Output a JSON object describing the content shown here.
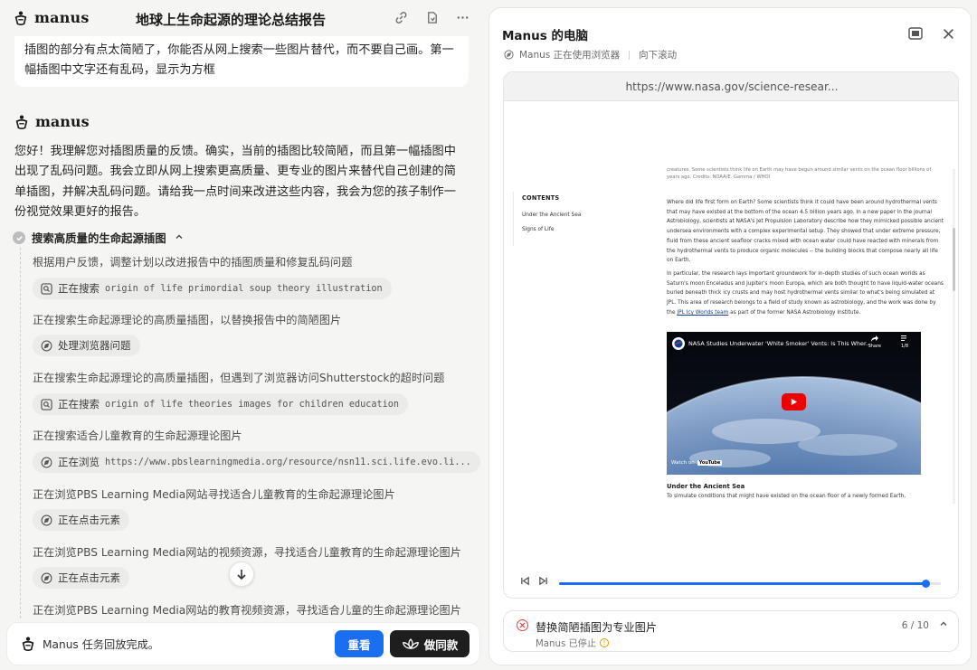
{
  "app": {
    "brand": "manus",
    "title": "地球上生命起源的理论总结报告"
  },
  "conversation": {
    "user_message": "插图的部分有点太简陋了，你能否从网上搜索一些图片替代，而不要自己画。第一幅插图中文字还有乱码，显示为方框",
    "assistant_name": "manus",
    "assistant_reply": "您好！我理解您对插图质量的反馈。确实，当前的插图比较简陋，而且第一幅插图中出现了乱码问题。我会立即从网上搜索更高质量、更专业的图片来替代自己创建的简单插图，并解决乱码问题。请给我一点时间来改进这些内容，我会为您的孩子制作一份视觉效果更好的报告。"
  },
  "task": {
    "title": "搜索高质量的生命起源插图",
    "chevron": "^"
  },
  "steps": [
    {
      "text": "根据用户反馈，调整计划以改进报告中的插图质量和修复乱码问题"
    },
    {
      "chip_verb": "正在搜索",
      "chip_arg": "origin of life primordial soup theory illustration",
      "icon": "search-icon"
    },
    {
      "text": "正在搜索生命起源理论的高质量插图，以替换报告中的简陋图片"
    },
    {
      "chip_verb": "处理浏览器问题",
      "chip_arg": "",
      "icon": "compass-icon"
    },
    {
      "text": "正在搜索生命起源理论的高质量插图，但遇到了浏览器访问Shutterstock的超时问题"
    },
    {
      "chip_verb": "正在搜索",
      "chip_arg": "origin of life theories images for children education",
      "icon": "search-icon"
    },
    {
      "text": "正在搜索适合儿童教育的生命起源理论图片"
    },
    {
      "chip_verb": "正在浏览",
      "chip_arg": "https://www.pbslearningmedia.org/resource/nsn11.sci.life.evo.li...",
      "icon": "compass-icon"
    },
    {
      "text": "正在浏览PBS Learning Media网站寻找适合儿童教育的生命起源理论图片"
    },
    {
      "chip_verb": "正在点击元素",
      "chip_arg": "",
      "icon": "compass-icon"
    },
    {
      "text": "正在浏览PBS Learning Media网站的视频资源，寻找适合儿童教育的生命起源理论图片"
    },
    {
      "chip_verb": "正在点击元素",
      "chip_arg": "",
      "icon": "compass-icon"
    },
    {
      "text": "正在浏览PBS Learning Media网站的教育视频资源，寻找适合儿童的生命起源理论图片"
    }
  ],
  "bottom": {
    "status": "Manus 任务回放完成。",
    "replay_label": "重看",
    "same_label": "做同款"
  },
  "computer": {
    "title": "Manus 的电脑",
    "using": "Manus 正在使用浏览器",
    "action": "向下滚动",
    "url": "https://www.nasa.gov/science-resear...",
    "page": {
      "top_caption": "creatures. Some scientists think life on Earth may have begun around similar vents on the ocean floor billions of years ago. Credits: NOAA/E. Gamma / WHOI",
      "toc_title": "CONTENTS",
      "toc_items": [
        "Under the Ancient Sea",
        "Signs of Life"
      ],
      "para1": "Where did life first form on Earth? Some scientists think it could have been around hydrothermal vents that may have existed at the bottom of the ocean 4.5 billion years ago. In a new paper in the journal Astrobiology, scientists at NASA's Jet Propulsion Laboratory describe how they mimicked possible ancient undersea environments with a complex experimental setup. They showed that under extreme pressure, fluid from these ancient seafloor cracks mixed with ocean water could have reacted with minerals from the hydrothermal vents to produce organic molecules -- the building blocks that compose nearly all life on Earth.",
      "para2_a": "In particular, the research lays important groundwork for in-depth studies of such ocean worlds as Saturn's moon Enceladus and Jupiter's moon Europa, which are both thought to have liquid-water oceans buried beneath thick icy crusts and may host hydrothermal vents similar to what's being simulated at JPL. This area of research belongs to a field of study known as astrobiology, and the work was done by the ",
      "para2_link": "JPL Icy Worlds team",
      "para2_b": " as part of the former NASA Astrobiology Institute.",
      "video_title": "NASA Studies Underwater 'White Smoker' Vents: Is This Wher...",
      "video_share": "Share",
      "video_count": "1/8",
      "watch_on": "Watch on",
      "youtube": "YouTube",
      "section_title": "Under the Ancient Sea",
      "section_text": "To simulate conditions that might have existed on the ocean floor of a newly formed Earth,"
    },
    "progress": 0.96,
    "current_task": "替换简陋插图为专业图片",
    "task_status": "Manus 已停止",
    "task_count": "6 / 10"
  },
  "colors": {
    "accent": "#1a6ef0",
    "error": "#e0414a",
    "warning": "#d99a00"
  }
}
